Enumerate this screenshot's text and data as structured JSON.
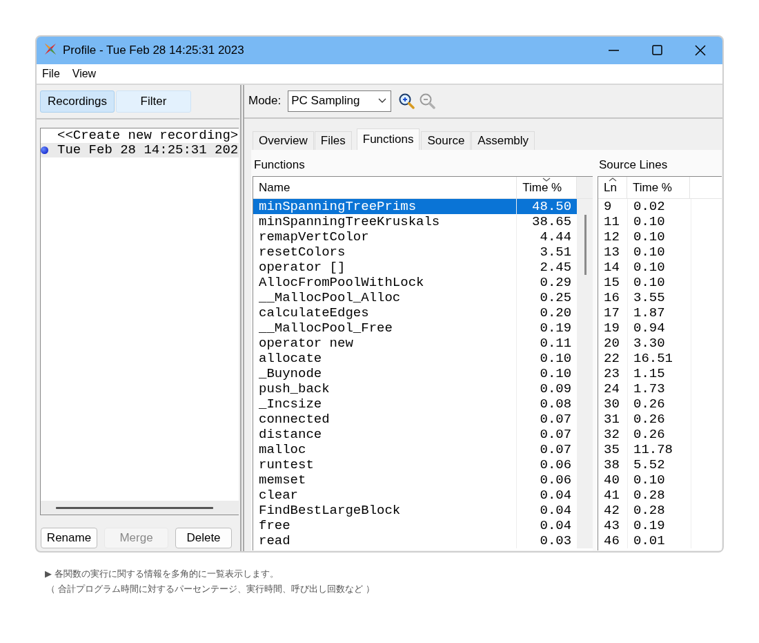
{
  "window": {
    "title": "Profile - Tue Feb 28 14:25:31 2023"
  },
  "menu": [
    "File",
    "View"
  ],
  "left_tabs": [
    {
      "label": "Recordings",
      "selected": true
    },
    {
      "label": "Filter",
      "selected": false
    }
  ],
  "recordings": [
    {
      "label": "<<Create new recording>",
      "selected": false,
      "active": false
    },
    {
      "label": "Tue Feb 28 14:25:31 202",
      "selected": true,
      "active": true
    }
  ],
  "recording_buttons": [
    {
      "label": "Rename",
      "disabled": false
    },
    {
      "label": "Merge",
      "disabled": true
    },
    {
      "label": "Delete",
      "disabled": false
    }
  ],
  "mode": {
    "label": "Mode:",
    "value": "PC Sampling"
  },
  "tabs": [
    {
      "label": "Overview",
      "selected": false
    },
    {
      "label": "Files",
      "selected": false
    },
    {
      "label": "Functions",
      "selected": true
    },
    {
      "label": "Source",
      "selected": false
    },
    {
      "label": "Assembly",
      "selected": false
    }
  ],
  "functions": {
    "title": "Functions",
    "columns": [
      {
        "label": "Name",
        "kind": "plain"
      },
      {
        "label": "Time %",
        "kind": "descending"
      }
    ],
    "rows": [
      {
        "name": "minSpanningTreePrims",
        "time": "48.50",
        "selected": true
      },
      {
        "name": "minSpanningTreeKruskals",
        "time": "38.65",
        "selected": false
      },
      {
        "name": "remapVertColor",
        "time": "4.44",
        "selected": false
      },
      {
        "name": "resetColors",
        "time": "3.51",
        "selected": false
      },
      {
        "name": "operator []",
        "time": "2.45",
        "selected": false
      },
      {
        "name": "AllocFromPoolWithLock",
        "time": "0.29",
        "selected": false
      },
      {
        "name": "__MallocPool_Alloc",
        "time": "0.25",
        "selected": false
      },
      {
        "name": "calculateEdges",
        "time": "0.20",
        "selected": false
      },
      {
        "name": "__MallocPool_Free",
        "time": "0.19",
        "selected": false
      },
      {
        "name": "operator new",
        "time": "0.11",
        "selected": false
      },
      {
        "name": "allocate",
        "time": "0.10",
        "selected": false
      },
      {
        "name": "_Buynode",
        "time": "0.10",
        "selected": false
      },
      {
        "name": "push_back",
        "time": "0.09",
        "selected": false
      },
      {
        "name": "_Incsize",
        "time": "0.08",
        "selected": false
      },
      {
        "name": "connected",
        "time": "0.07",
        "selected": false
      },
      {
        "name": "distance",
        "time": "0.07",
        "selected": false
      },
      {
        "name": "malloc",
        "time": "0.07",
        "selected": false
      },
      {
        "name": "runtest",
        "time": "0.06",
        "selected": false
      },
      {
        "name": "memset",
        "time": "0.06",
        "selected": false
      },
      {
        "name": "clear",
        "time": "0.04",
        "selected": false
      },
      {
        "name": "FindBestLargeBlock",
        "time": "0.04",
        "selected": false
      },
      {
        "name": "free",
        "time": "0.04",
        "selected": false
      },
      {
        "name": "read",
        "time": "0.03",
        "selected": false
      }
    ]
  },
  "source_lines": {
    "title": "Source Lines",
    "columns": [
      {
        "label": "Ln",
        "kind": "ascending"
      },
      {
        "label": "Time %",
        "kind": "plain"
      }
    ],
    "rows": [
      {
        "line": "9",
        "time": "0.02"
      },
      {
        "line": "11",
        "time": "0.10"
      },
      {
        "line": "12",
        "time": "0.10"
      },
      {
        "line": "13",
        "time": "0.10"
      },
      {
        "line": "14",
        "time": "0.10"
      },
      {
        "line": "15",
        "time": "0.10"
      },
      {
        "line": "16",
        "time": "3.55"
      },
      {
        "line": "17",
        "time": "1.87"
      },
      {
        "line": "19",
        "time": "0.94"
      },
      {
        "line": "20",
        "time": "3.30"
      },
      {
        "line": "22",
        "time": "16.51"
      },
      {
        "line": "23",
        "time": "1.15"
      },
      {
        "line": "24",
        "time": "1.73"
      },
      {
        "line": "30",
        "time": "0.26"
      },
      {
        "line": "31",
        "time": "0.26"
      },
      {
        "line": "32",
        "time": "0.26"
      },
      {
        "line": "35",
        "time": "11.78"
      },
      {
        "line": "38",
        "time": "5.52"
      },
      {
        "line": "40",
        "time": "0.10"
      },
      {
        "line": "41",
        "time": "0.28"
      },
      {
        "line": "42",
        "time": "0.28"
      },
      {
        "line": "43",
        "time": "0.19"
      },
      {
        "line": "46",
        "time": "0.01"
      }
    ]
  },
  "caption": [
    "▶ 各関数の実行に関する情報を多角的に一覧表示します。",
    "（ 合計プログラム時間に対するパーセンテージ、実行時間、呼び出し回数など ）"
  ]
}
